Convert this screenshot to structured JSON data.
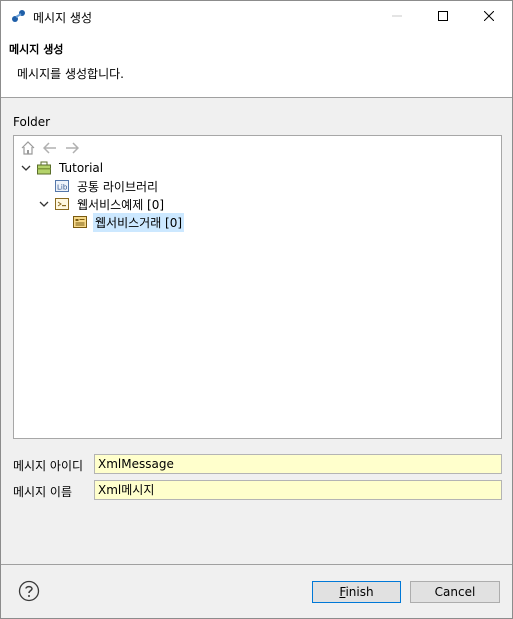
{
  "window": {
    "title": "메시지 생성"
  },
  "banner": {
    "title": "메시지 생성",
    "message": "메시지를 생성합니다."
  },
  "folder": {
    "label": "Folder",
    "tree": [
      {
        "label": "Tutorial",
        "expanded": true,
        "icon": "project-icon"
      },
      {
        "label": "공통 라이브러리",
        "icon": "library-icon"
      },
      {
        "label": "웹서비스예제 [0]",
        "expanded": true,
        "icon": "package-icon"
      },
      {
        "label": "웹서비스거래 [0]",
        "selected": true,
        "icon": "transaction-icon"
      }
    ]
  },
  "form": {
    "message_id_label": "메시지 아이디",
    "message_id_value": "XmlMessage",
    "message_name_label": "메시지 이름",
    "message_name_value": "Xml메시지"
  },
  "buttons": {
    "finish": "Finish",
    "cancel": "Cancel"
  },
  "colors": {
    "input_bg": "#ffffcc",
    "selection": "#cce8ff",
    "primary_border": "#0078d7"
  }
}
